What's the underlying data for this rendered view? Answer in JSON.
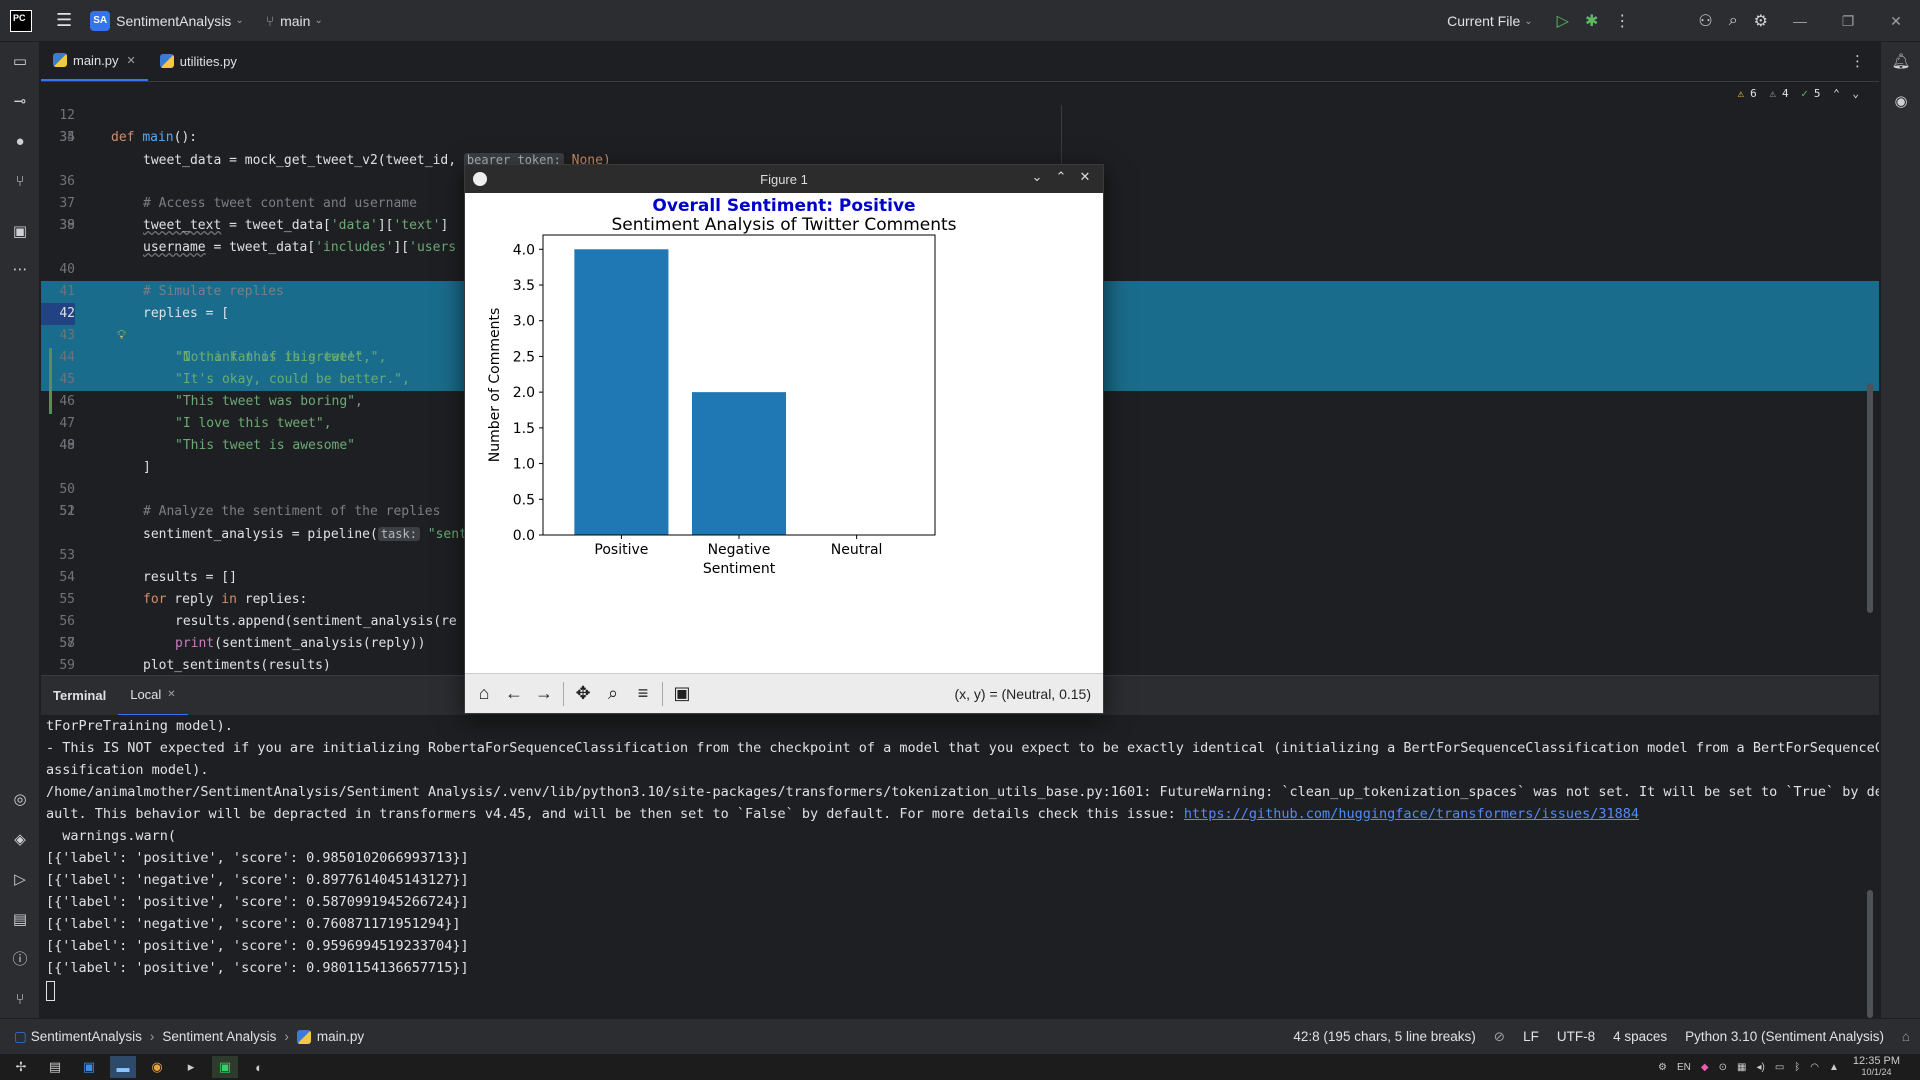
{
  "titlebar": {
    "project_badge": "SA",
    "project_name": "SentimentAnalysis",
    "branch": "main",
    "run_config": "Current File"
  },
  "tabs": [
    {
      "label": "main.py"
    },
    {
      "label": "utilities.py"
    }
  ],
  "inspections": {
    "warnings": "6",
    "weak_warnings": "4",
    "ok": "5"
  },
  "editor": {
    "sticky_line": {
      "num": "12",
      "text": "def main():"
    },
    "lines": [
      {
        "num": "34"
      },
      {
        "num": "35"
      },
      {
        "num": "36"
      },
      {
        "num": "37"
      },
      {
        "num": "38"
      },
      {
        "num": "39"
      },
      {
        "num": "40"
      },
      {
        "num": "41"
      },
      {
        "num": "42"
      },
      {
        "num": "43"
      },
      {
        "num": "44"
      },
      {
        "num": "45"
      },
      {
        "num": "46"
      },
      {
        "num": "47"
      },
      {
        "num": "48"
      },
      {
        "num": "49"
      },
      {
        "num": "50"
      },
      {
        "num": "51"
      },
      {
        "num": "52"
      },
      {
        "num": "53"
      },
      {
        "num": "54"
      },
      {
        "num": "55"
      },
      {
        "num": "56"
      },
      {
        "num": "57"
      },
      {
        "num": "58"
      },
      {
        "num": "59"
      }
    ],
    "code": {
      "l34_a": "tweet_data = mock_get_tweet_v2(tweet_id, ",
      "l34_hint": "bearer_token:",
      "l34_b": " None)",
      "l36": "# Access tweet content and username",
      "l37_a": "tweet_text",
      "l37_b": " = tweet_data[",
      "l37_s1": "'data'",
      "l37_c": "][",
      "l37_s2": "'text'",
      "l37_d": "]",
      "l38_a": "username",
      "l38_b": " = tweet_data[",
      "l38_s1": "'includes'",
      "l38_c": "][",
      "l38_s2": "'users",
      "l40": "# Simulate replies",
      "l41": "replies = [",
      "l42": "\"I think this is great!\",",
      "l43": "\"Not a fan of this tweet.\",",
      "l44": "\"It's okay, could be better.\",",
      "l45": "\"This tweet was boring\",",
      "l46": "\"I love this tweet\",",
      "l47": "\"This tweet is awesome\"",
      "l48": "]",
      "l50": "# Analyze the sentiment of the replies",
      "l51_a": "sentiment_analysis = pipeline(",
      "l51_hint": "task:",
      "l51_b": " \"sent",
      "l53": "results = []",
      "l54_kw": "for",
      "l54_a": " reply ",
      "l54_kw2": "in",
      "l54_b": " replies:",
      "l55": "results.append(sentiment_analysis(re",
      "l56_fn": "print",
      "l56_b": "(sentiment_analysis(reply))",
      "l57": "plot_sentiments(results)"
    }
  },
  "terminal": {
    "tab_title": "Terminal",
    "session_tab": "Local",
    "lines": [
      "tForPreTraining model).",
      "- This IS NOT expected if you are initializing RobertaForSequenceClassification from the checkpoint of a model that you expect to be exactly identical (initializing a BertForSequenceClassification model from a BertForSequenceCl",
      "assification model).",
      "/home/animalmother/SentimentAnalysis/Sentiment Analysis/.venv/lib/python3.10/site-packages/transformers/tokenization_utils_base.py:1601: FutureWarning: `clean_up_tokenization_spaces` was not set. It will be set to `True` by def",
      "ault. This behavior will be depracted in transformers v4.45, and will be then set to `False` by default. For more details check this issue: ",
      "  warnings.warn(",
      "[{'label': 'positive', 'score': 0.9850102066993713}]",
      "[{'label': 'negative', 'score': 0.8977614045143127}]",
      "[{'label': 'positive', 'score': 0.5870991945266724}]",
      "[{'label': 'negative', 'score': 0.760871171951294}]",
      "[{'label': 'positive', 'score': 0.9596994519233704}]",
      "[{'label': 'positive', 'score': 0.9801154136657715}]"
    ],
    "issue_link": "https://github.com/huggingface/transformers/issues/31884"
  },
  "figure": {
    "window_title": "Figure 1",
    "coords_readout": "(x, y) = (Neutral, 0.15)"
  },
  "chart_data": {
    "type": "bar",
    "suptitle": "Overall Sentiment: Positive",
    "suptitle_color": "#0000cc",
    "title": "Sentiment Analysis of Twitter Comments",
    "xlabel": "Sentiment",
    "ylabel": "Number of Comments",
    "categories": [
      "Positive",
      "Negative",
      "Neutral"
    ],
    "values": [
      4,
      2,
      0
    ],
    "ylim": [
      0,
      4.2
    ],
    "yticks": [
      "0.0",
      "0.5",
      "1.0",
      "1.5",
      "2.0",
      "2.5",
      "3.0",
      "3.5",
      "4.0"
    ],
    "bar_color": "#1f77b4",
    "grid": false
  },
  "statusbar": {
    "crumbs": [
      "SentimentAnalysis",
      "Sentiment Analysis",
      "main.py"
    ],
    "position": "42:8 (195 chars, 5 line breaks)",
    "line_sep": "LF",
    "encoding": "UTF-8",
    "indent": "4 spaces",
    "interpreter": "Python 3.10 (Sentiment Analysis)"
  },
  "taskbar": {
    "lang": "EN",
    "time": "12:35 PM",
    "date": "10/1/24"
  }
}
